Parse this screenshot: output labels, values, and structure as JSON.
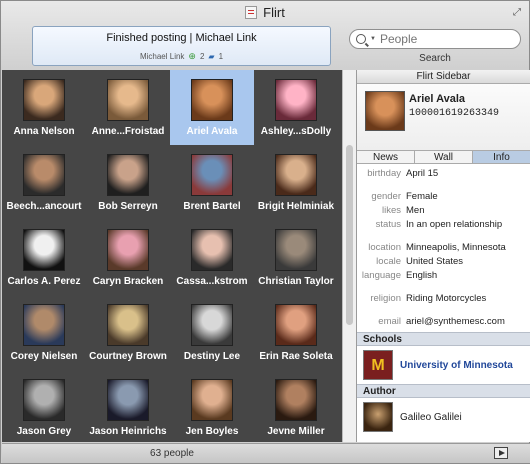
{
  "window": {
    "title": "Flirt"
  },
  "status": {
    "message": "Finished posting | Michael Link",
    "author": "Michael Link",
    "likes": "2",
    "comments": "1"
  },
  "search": {
    "placeholder": "People",
    "label": "Search"
  },
  "people": [
    {
      "name": "Anna Nelson",
      "colors": [
        "#d9a77a",
        "#3b2a1f"
      ]
    },
    {
      "name": "Anne...Froistad",
      "colors": [
        "#e6b98c",
        "#7a5a3a"
      ]
    },
    {
      "name": "Ariel Avala",
      "colors": [
        "#d8915a",
        "#6b3a1a"
      ],
      "selected": true
    },
    {
      "name": "Ashley...sDolly",
      "colors": [
        "#ffb3c6",
        "#6a2a3a"
      ]
    },
    {
      "name": "Beech...ancourt",
      "colors": [
        "#b98b6a",
        "#2b2b2b"
      ]
    },
    {
      "name": "Bob Serreyn",
      "colors": [
        "#c9a28a",
        "#1f1f1f"
      ]
    },
    {
      "name": "Brent Bartel",
      "colors": [
        "#6a8fb8",
        "#8a3a3a"
      ]
    },
    {
      "name": "Brigit Helminiak",
      "colors": [
        "#d9b08c",
        "#4a2a1a"
      ]
    },
    {
      "name": "Carlos A. Perez",
      "colors": [
        "#f0f0f0",
        "#111111"
      ]
    },
    {
      "name": "Caryn Bracken",
      "colors": [
        "#e8a0b0",
        "#5a3a2a"
      ]
    },
    {
      "name": "Cassa...kstrom",
      "colors": [
        "#e7c0b0",
        "#2a2a2a"
      ]
    },
    {
      "name": "Christian Taylor",
      "colors": [
        "#9a8a7a",
        "#3a3a3a"
      ]
    },
    {
      "name": "Corey Nielsen",
      "colors": [
        "#b08a6a",
        "#2a3a5a"
      ]
    },
    {
      "name": "Courtney Brown",
      "colors": [
        "#d9c08a",
        "#4a3a2a"
      ]
    },
    {
      "name": "Destiny Lee",
      "colors": [
        "#d8d8d8",
        "#3a3a3a"
      ]
    },
    {
      "name": "Erin Rae Soleta",
      "colors": [
        "#e0a080",
        "#5a2a1a"
      ]
    },
    {
      "name": "Jason Grey",
      "colors": [
        "#b0b0b0",
        "#2a2a2a"
      ]
    },
    {
      "name": "Jason Heinrichs",
      "colors": [
        "#8a9ab0",
        "#1a1a2a"
      ]
    },
    {
      "name": "Jen Boyles",
      "colors": [
        "#e0b090",
        "#5a3a20"
      ]
    },
    {
      "name": "Jevne Miller",
      "colors": [
        "#b08060",
        "#2a1a10"
      ]
    }
  ],
  "footer": {
    "count": "63 people"
  },
  "sidebar": {
    "title": "Flirt Sidebar",
    "name": "Ariel Avala",
    "id": "100001619263349",
    "tabs": [
      "News",
      "Wall",
      "Info"
    ],
    "info": [
      {
        "k": "birthday",
        "v": "April 15"
      },
      {
        "k": "",
        "v": ""
      },
      {
        "k": "gender",
        "v": "Female"
      },
      {
        "k": "likes",
        "v": "Men"
      },
      {
        "k": "status",
        "v": "In an open relationship"
      },
      {
        "k": "",
        "v": ""
      },
      {
        "k": "location",
        "v": "Minneapolis, Minnesota"
      },
      {
        "k": "locale",
        "v": "United States"
      },
      {
        "k": "language",
        "v": "English"
      },
      {
        "k": "",
        "v": ""
      },
      {
        "k": "religion",
        "v": "Riding Motorcycles"
      },
      {
        "k": "",
        "v": ""
      },
      {
        "k": "email",
        "v": "ariel@synthemesc.com"
      }
    ],
    "schools_title": "Schools",
    "school": "University of Minnesota",
    "school_logo": "M",
    "author_title": "Author",
    "author": "Galileo Galilei"
  }
}
